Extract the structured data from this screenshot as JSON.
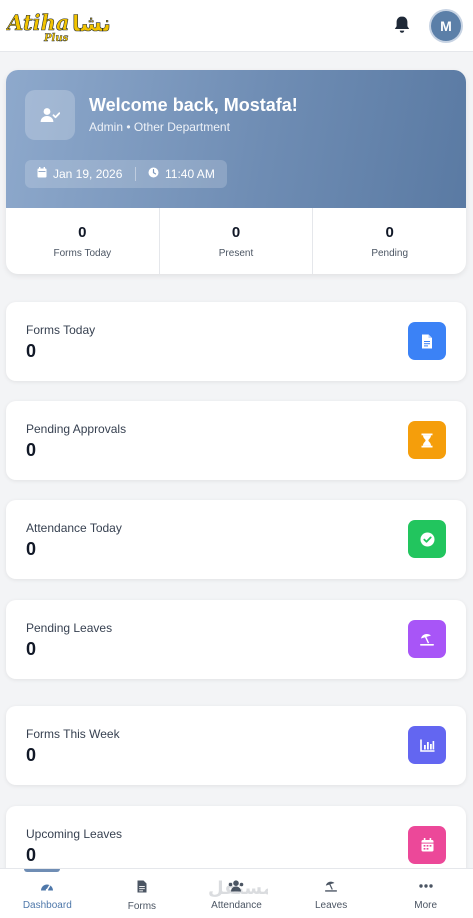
{
  "header": {
    "logo_text": "Atiha",
    "logo_sub": "Plus",
    "logo_arabic": "انشا",
    "avatar_initial": "M",
    "icons": [
      "bell-icon"
    ]
  },
  "hero": {
    "title": "Welcome back, Mostafa!",
    "subtitle": "Admin • Other Department",
    "date": "Jan 19, 2026",
    "time": "11:40 AM",
    "icon": "user-check-icon",
    "stats": [
      {
        "value": "0",
        "label": "Forms Today"
      },
      {
        "value": "0",
        "label": "Present"
      },
      {
        "value": "0",
        "label": "Pending"
      }
    ]
  },
  "cards": [
    {
      "label": "Forms Today",
      "value": "0",
      "icon": "document-icon",
      "color": "#3b82f6"
    },
    {
      "label": "Pending Approvals",
      "value": "0",
      "icon": "hourglass-icon",
      "color": "#f59e0b"
    },
    {
      "label": "Attendance Today",
      "value": "0",
      "icon": "check-circle-icon",
      "color": "#22c55e"
    },
    {
      "label": "Pending Leaves",
      "value": "0",
      "icon": "umbrella-beach-icon",
      "color": "#a855f7"
    },
    {
      "label": "Forms This Week",
      "value": "0",
      "icon": "chart-bar-icon",
      "color": "#6366f1"
    },
    {
      "label": "Upcoming Leaves",
      "value": "0",
      "icon": "calendar-icon",
      "color": "#ec4899"
    }
  ],
  "nav": [
    {
      "label": "Dashboard",
      "icon": "gauge-icon",
      "active": true
    },
    {
      "label": "Forms",
      "icon": "file-icon"
    },
    {
      "label": "Attendance",
      "icon": "users-icon"
    },
    {
      "label": "Leaves",
      "icon": "umbrella-beach-icon"
    },
    {
      "label": "More",
      "icon": "ellipsis-icon"
    }
  ],
  "watermark_text": "مستقل"
}
